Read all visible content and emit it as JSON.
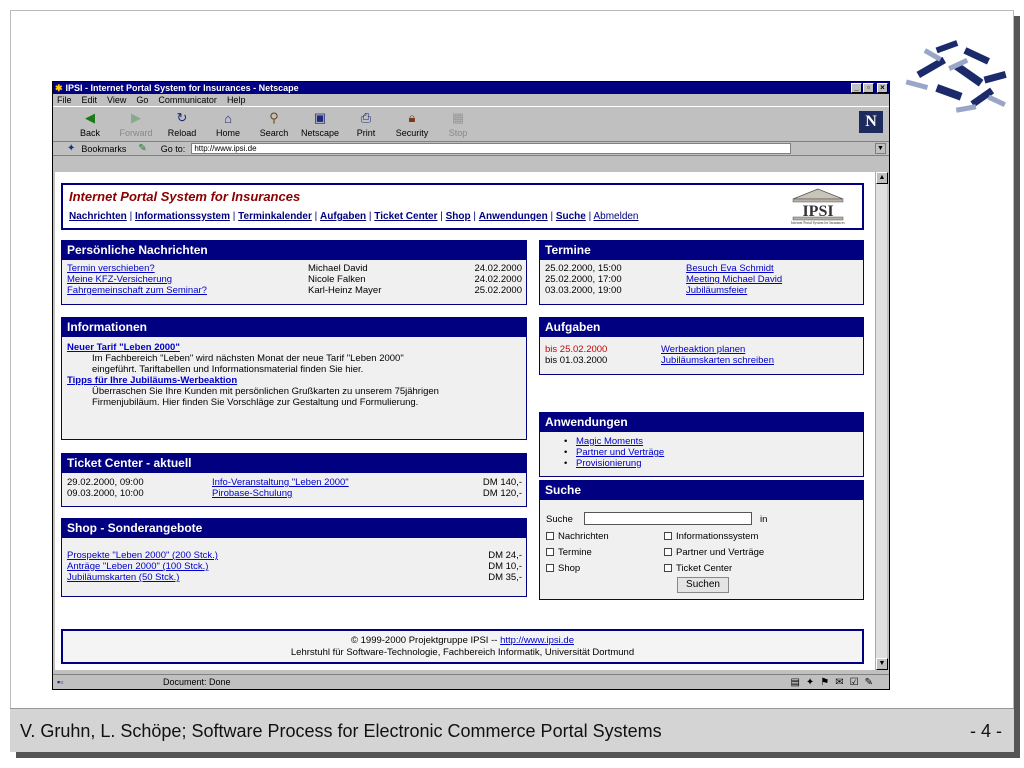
{
  "browser": {
    "title": "IPSI - Internet Portal System for Insurances - Netscape",
    "menus": [
      "File",
      "Edit",
      "View",
      "Go",
      "Communicator",
      "Help"
    ],
    "toolbar": [
      {
        "label": "Back",
        "icon": "back-arrow-icon"
      },
      {
        "label": "Forward",
        "icon": "forward-arrow-icon",
        "disabled": true
      },
      {
        "label": "Reload",
        "icon": "reload-icon"
      },
      {
        "label": "Home",
        "icon": "home-icon"
      },
      {
        "label": "Search",
        "icon": "search-icon"
      },
      {
        "label": "Netscape",
        "icon": "netscape-icon"
      },
      {
        "label": "Print",
        "icon": "print-icon"
      },
      {
        "label": "Security",
        "icon": "lock-icon"
      },
      {
        "label": "Stop",
        "icon": "stop-icon",
        "disabled": true
      }
    ],
    "bookmarks_label": "Bookmarks",
    "goto_label": "Go to:",
    "url": "http://www.ipsi.de",
    "status": "Document: Done"
  },
  "portal": {
    "title": "Internet Portal System for Insurances",
    "nav": [
      "Nachrichten",
      "Informationssystem",
      "Terminkalender",
      "Aufgaben",
      "Ticket Center",
      "Shop",
      "Anwendungen",
      "Suche",
      "Abmelden"
    ],
    "logo_text": "IPSI",
    "logo_caption": "Internet Portal System for Insurances"
  },
  "nachrichten": {
    "header": "Persönliche Nachrichten",
    "rows": [
      {
        "subject": "Termin verschieben?",
        "from": "Michael David",
        "date": "24.02.2000"
      },
      {
        "subject": "Meine KFZ-Versicherung",
        "from": "Nicole Falken",
        "date": "24.02.2000"
      },
      {
        "subject": "Fahrgemeinschaft zum Seminar?",
        "from": "Karl-Heinz Mayer",
        "date": "25.02.2000"
      }
    ]
  },
  "informationen": {
    "header": "Informationen",
    "items": [
      {
        "title": "Neuer Tarif \"Leben 2000\"",
        "line1": "Im Fachbereich \"Leben\" wird nächsten Monat der neue Tarif \"Leben 2000\"",
        "line2": "eingeführt. Tariftabellen und Informationsmaterial finden Sie hier."
      },
      {
        "title": "Tipps für Ihre Jubiläums-Werbeaktion",
        "line1": "Überraschen Sie Ihre Kunden mit persönlichen Grußkarten zu unserem 75jährigen",
        "line2": "Firmenjubiläum. Hier finden Sie Vorschläge zur Gestaltung und Formulierung."
      }
    ]
  },
  "termine": {
    "header": "Termine",
    "rows": [
      {
        "when": "25.02.2000, 15:00",
        "what": "Besuch Eva Schmidt"
      },
      {
        "when": "25.02.2000, 17:00",
        "what": "Meeting Michael David"
      },
      {
        "when": "03.03.2000, 19:00",
        "what": "Jubiläumsfeier"
      }
    ]
  },
  "aufgaben": {
    "header": "Aufgaben",
    "rows": [
      {
        "due": "bis 25.02.2000",
        "task": "Werbeaktion planen",
        "overdue": true
      },
      {
        "due": "bis 01.03.2000",
        "task": "Jubiläumskarten schreiben",
        "overdue": false
      }
    ]
  },
  "ticket": {
    "header": "Ticket Center - aktuell",
    "rows": [
      {
        "when": "29.02.2000, 09:00",
        "event": "Info-Veranstaltung \"Leben 2000\"",
        "price": "DM 140,-"
      },
      {
        "when": "09.03.2000, 10:00",
        "event": "Pirobase-Schulung",
        "price": "DM 120,-"
      }
    ]
  },
  "shop": {
    "header": "Shop - Sonderangebote",
    "rows": [
      {
        "item": "Prospekte \"Leben 2000\" (200 Stck.)",
        "price": "DM 24,-"
      },
      {
        "item": "Anträge \"Leben 2000\" (100 Stck.)",
        "price": "DM 10,-"
      },
      {
        "item": "Jubiläumskarten (50 Stck.)",
        "price": "DM 35,-"
      }
    ]
  },
  "anwendungen": {
    "header": "Anwendungen",
    "items": [
      "Magic Moments",
      "Partner und Verträge",
      "Provisionierung"
    ]
  },
  "suche": {
    "header": "Suche",
    "label": "Suche",
    "in_label": "in",
    "options": [
      "Nachrichten",
      "Informationssystem",
      "Termine",
      "Partner und Verträge",
      "Shop",
      "Ticket Center"
    ],
    "button": "Suchen"
  },
  "page_footer": {
    "copyright": "© 1999-2000 Projektgruppe IPSI --",
    "link": "http://www.ipsi.de",
    "line2": "Lehrstuhl für Software-Technologie, Fachbereich Informatik, Universität Dortmund"
  },
  "slide": {
    "footer": "V. Gruhn, L. Schöpe; Software Process for Electronic Commerce Portal Systems",
    "page": "- 4 -"
  }
}
